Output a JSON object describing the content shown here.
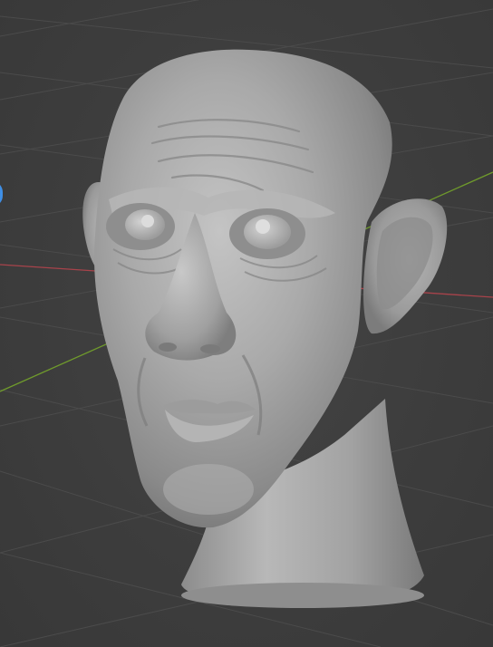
{
  "app": "3D viewport",
  "viewport": {
    "background": "#3d3d3d",
    "grid_color": "#4c4c4c",
    "x_axis_color": "#a8434b",
    "y_axis_color": "#6f9a2c",
    "gizmo_color": "#3f8fe6"
  },
  "scene": {
    "object": "sculpted-head",
    "shading": "solid",
    "material_color": "#a6a6a6"
  }
}
